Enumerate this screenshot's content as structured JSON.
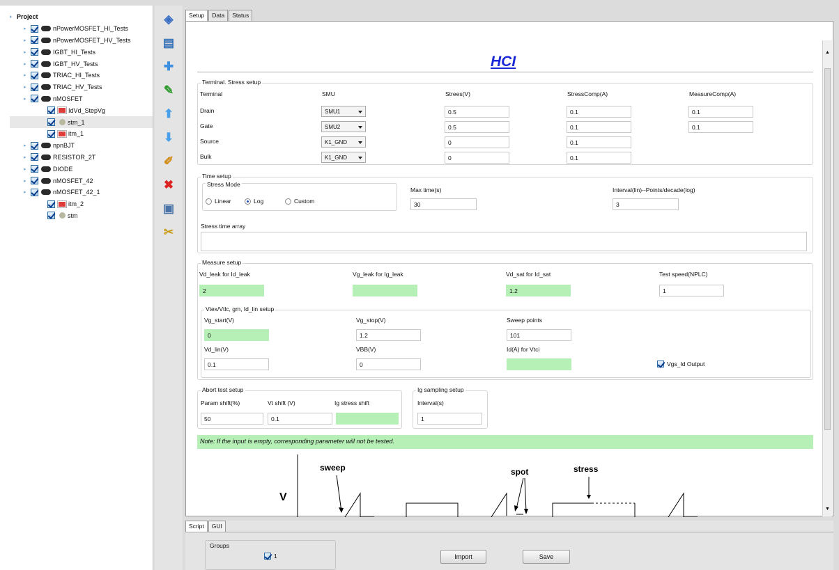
{
  "tree": {
    "root": "Project",
    "items": [
      {
        "label": "nPowerMOSFET_HI_Tests",
        "level": 1,
        "icon": "chip-icon"
      },
      {
        "label": "nPowerMOSFET_HV_Tests",
        "level": 1,
        "icon": "chip-icon"
      },
      {
        "label": "IGBT_HI_Tests",
        "level": 1,
        "icon": "chip-icon"
      },
      {
        "label": "IGBT_HV_Tests",
        "level": 1,
        "icon": "chip-icon"
      },
      {
        "label": "TRIAC_HI_Tests",
        "level": 1,
        "icon": "chip-icon"
      },
      {
        "label": "TRIAC_HV_Tests",
        "level": 1,
        "icon": "chip-icon"
      },
      {
        "label": "nMOSFET",
        "level": 1,
        "icon": "chip-icon"
      },
      {
        "label": "IdVd_StepVg",
        "level": 2,
        "icon": "measure-icon"
      },
      {
        "label": "stm_1",
        "level": 2,
        "icon": "stress-icon",
        "selected": true
      },
      {
        "label": "itm_1",
        "level": 2,
        "icon": "measure-icon"
      },
      {
        "label": "npnBJT",
        "level": 1,
        "icon": "chip-icon"
      },
      {
        "label": "RESISTOR_2T",
        "level": 1,
        "icon": "chip-icon"
      },
      {
        "label": "DIODE",
        "level": 1,
        "icon": "chip-icon"
      },
      {
        "label": "nMOSFET_42",
        "level": 1,
        "icon": "chip-icon"
      },
      {
        "label": "nMOSFET_42_1",
        "level": 1,
        "icon": "chip-icon"
      },
      {
        "label": "itm_2",
        "level": 2,
        "icon": "measure-icon"
      },
      {
        "label": "stm",
        "level": 2,
        "icon": "stress-icon"
      }
    ]
  },
  "toolbar": [
    "cube-icon",
    "edit-doc-icon",
    "plus-icon",
    "pencil-icon",
    "up-arrow-icon",
    "down-arrow-icon",
    "brush-icon",
    "delete-icon",
    "page-icon",
    "scissors-icon"
  ],
  "tabs": {
    "setup": "Setup",
    "data": "Data",
    "status": "Status"
  },
  "title": "HCI",
  "terminal": {
    "legend": "Terminal. Stress setup",
    "headers": [
      "Terminal",
      "SMU",
      "Strees(V)",
      "StressComp(A)",
      "MeasureComp(A)"
    ],
    "rows": [
      {
        "name": "Drain",
        "smu": "SMU1",
        "stress": "0.5",
        "scomp": "0.1",
        "mcomp": "0.1"
      },
      {
        "name": "Gate",
        "smu": "SMU2",
        "stress": "0.5",
        "scomp": "0.1",
        "mcomp": "0.1"
      },
      {
        "name": "Source",
        "smu": "K1_GND",
        "stress": "0",
        "scomp": "0.1"
      },
      {
        "name": "Bulk",
        "smu": "K1_GND",
        "stress": "0",
        "scomp": "0.1"
      }
    ]
  },
  "time": {
    "legend": "Time setup",
    "mode_label": "Stress Mode",
    "linear": "Linear",
    "log": "Log",
    "custom": "Custom",
    "max_label": "Max time(s)",
    "max": "30",
    "interval_label": "Interval(lin)--Points/decade(log)",
    "interval": "3",
    "array_label": "Stress time array",
    "array": ""
  },
  "measure": {
    "legend": "Measure setup",
    "vd_leak_label": "Vd_leak for Id_leak",
    "vd_leak": "2",
    "vg_leak_label": "Vg_leak for Ig_leak",
    "vg_leak": "",
    "vd_sat_label": "Vd_sat for Id_sat",
    "vd_sat": "1.2",
    "speed_label": "Test speed(NPLC)",
    "speed": "1",
    "vt_legend": "Vtex/Vtlc, gm, Id_lin setup",
    "vg_start_label": "Vg_start(V)",
    "vg_start": "0",
    "vg_stop_label": "Vg_stop(V)",
    "vg_stop": "1.2",
    "sweep_label": "Sweep points",
    "sweep": "101",
    "vd_lin_label": "Vd_lin(V)",
    "vd_lin": "0.1",
    "vbb_label": "VBB(V)",
    "vbb": "0",
    "id_label": "Id(A) for Vtci",
    "id": "",
    "vgs_label": "Vgs_Id Output"
  },
  "abort": {
    "legend": "Abort test setup",
    "param_label": "Param shift(%)",
    "param": "50",
    "vt_label": "Vt shift (V)",
    "vt": "0.1",
    "ig_label": "Ig stress shift",
    "ig": ""
  },
  "ig": {
    "legend": "Ig sampling setup",
    "interval_label": "Interval(s)",
    "interval": "1"
  },
  "note": "Note: If the input is empty, corresponding parameter will not be tested.",
  "diagram": {
    "v": "V",
    "sweep": "sweep",
    "spot": "spot",
    "stress": "stress"
  },
  "bottom": {
    "script_tab": "Script",
    "gui_tab": "GUI",
    "groups_label": "Groups",
    "group_value": "1",
    "import": "Import",
    "save": "Save"
  }
}
